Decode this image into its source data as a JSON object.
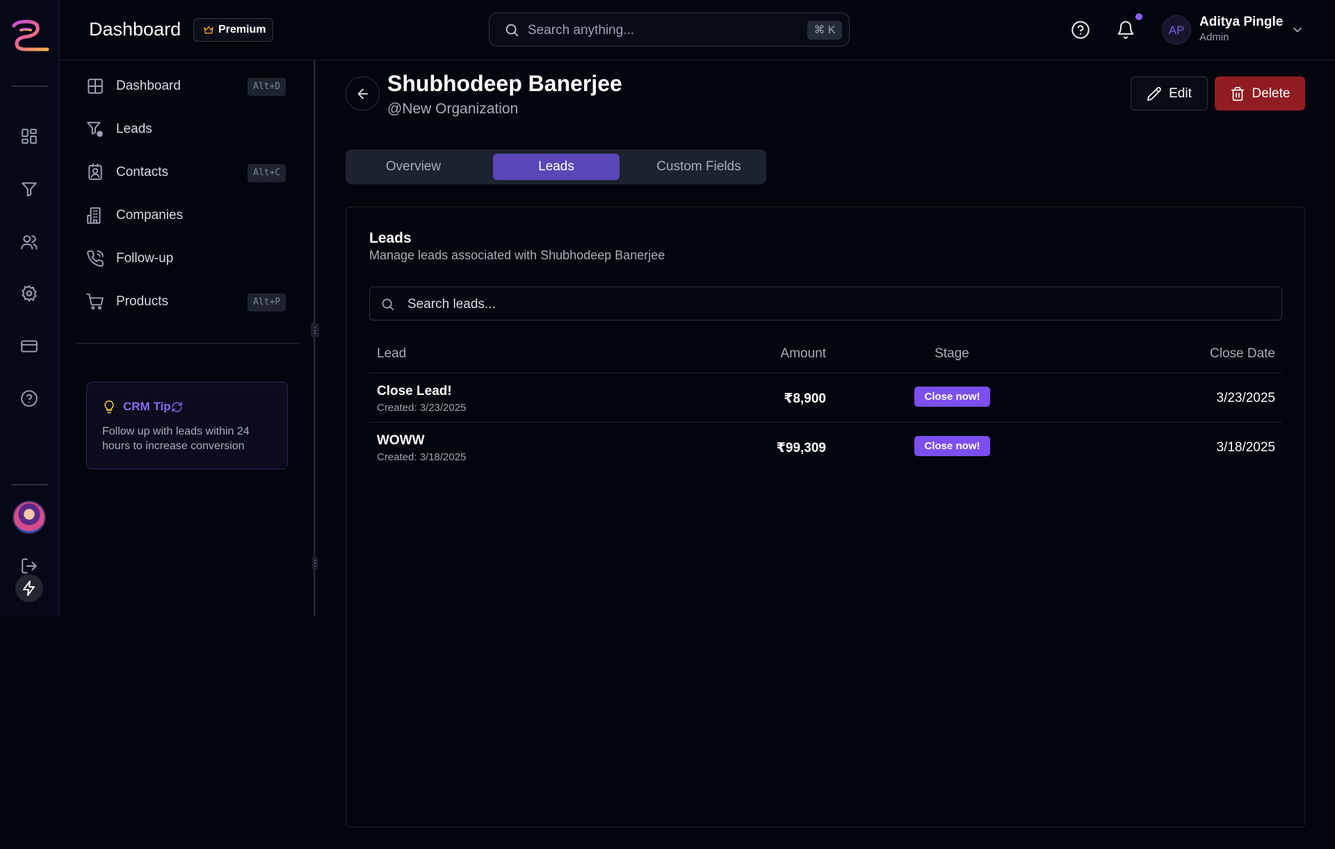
{
  "header": {
    "title": "Dashboard",
    "premium_label": "Premium",
    "search_placeholder": "Search anything...",
    "search_shortcut": "⌘ K",
    "user": {
      "initials": "AP",
      "name": "Aditya Pingle",
      "role": "Admin"
    }
  },
  "sidebar": {
    "items": [
      {
        "label": "Dashboard",
        "shortcut": "Alt+D",
        "icon": "layout-grid-icon"
      },
      {
        "label": "Leads",
        "shortcut": "",
        "icon": "funnel-dollar-icon"
      },
      {
        "label": "Contacts",
        "shortcut": "Alt+C",
        "icon": "contact-book-icon"
      },
      {
        "label": "Companies",
        "shortcut": "",
        "icon": "building-icon"
      },
      {
        "label": "Follow-up",
        "shortcut": "",
        "icon": "phone-icon"
      },
      {
        "label": "Products",
        "shortcut": "Alt+P",
        "icon": "cart-icon"
      }
    ],
    "tip": {
      "title": "CRM Tip",
      "text": "Follow up with leads within 24 hours to increase conversion"
    }
  },
  "contact": {
    "name": "Shubhodeep Banerjee",
    "organization": "@New Organization",
    "edit_label": "Edit",
    "delete_label": "Delete"
  },
  "tabs": [
    {
      "label": "Overview",
      "active": false
    },
    {
      "label": "Leads",
      "active": true
    },
    {
      "label": "Custom Fields",
      "active": false
    }
  ],
  "leads_card": {
    "title": "Leads",
    "subtitle": "Manage leads associated with Shubhodeep Banerjee",
    "search_placeholder": "Search leads...",
    "columns": [
      "Lead",
      "Amount",
      "Stage",
      "Close Date"
    ],
    "rows": [
      {
        "name": "Close Lead!",
        "created": "Created: 3/23/2025",
        "amount": "₹8,900",
        "stage": "Close now!",
        "close_date": "3/23/2025"
      },
      {
        "name": "WOWW",
        "created": "Created: 3/18/2025",
        "amount": "₹99,309",
        "stage": "Close now!",
        "close_date": "3/18/2025"
      }
    ]
  },
  "colors": {
    "accent": "#5b46b8",
    "stage_badge": "#7c4ff0",
    "delete": "#8f1d22",
    "background": "#03050e"
  }
}
